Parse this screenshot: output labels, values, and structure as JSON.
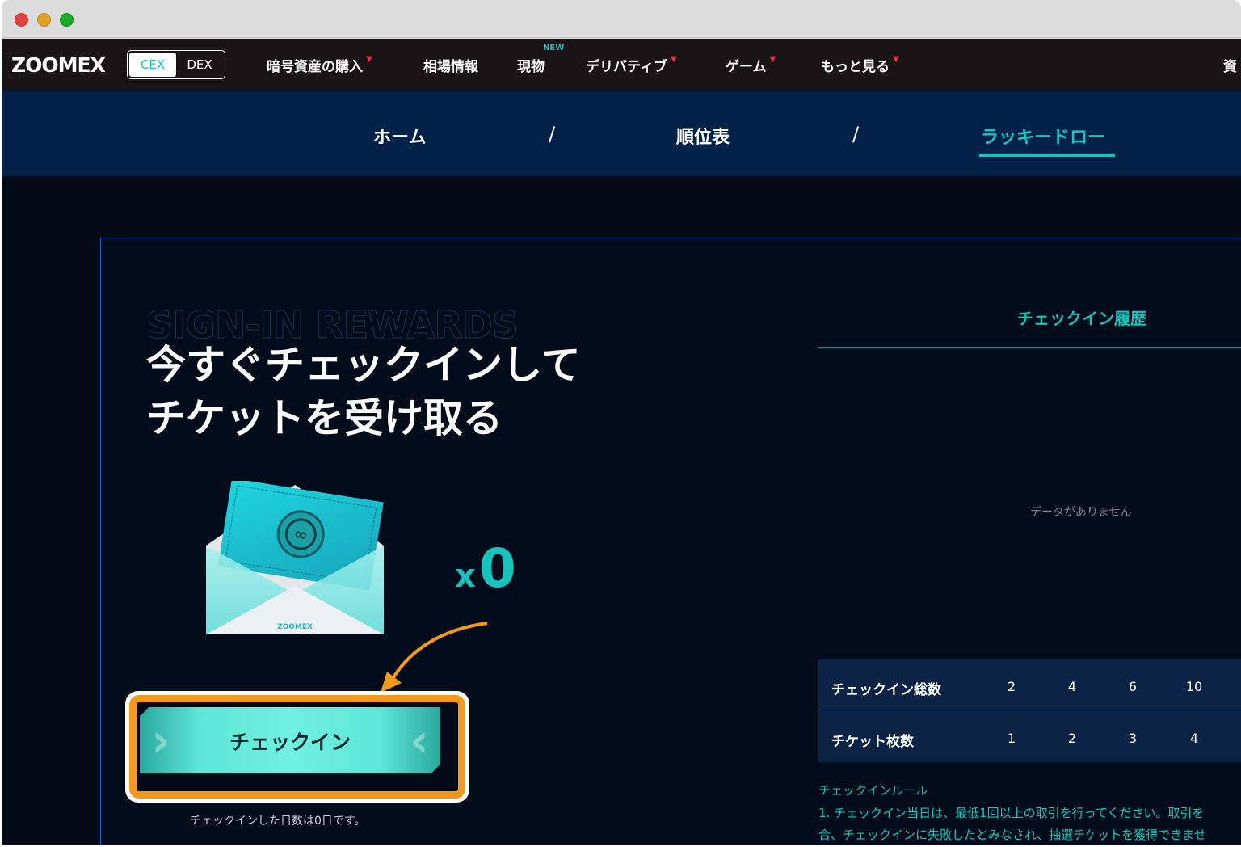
{
  "nav": {
    "logo": "ZOOMEX",
    "switch": {
      "cex": "CEX",
      "dex": "DEX"
    },
    "items": [
      {
        "label": "暗号資産の購入",
        "caret": "▼"
      },
      {
        "label": "相場情報"
      },
      {
        "label": "現物",
        "badge": "NEW"
      },
      {
        "label": "デリバティブ",
        "caret": "▼"
      },
      {
        "label": "ゲーム",
        "caret": "▼"
      },
      {
        "label": "もっと見る",
        "caret": "▼"
      }
    ],
    "right_truncated": "資"
  },
  "subnav": {
    "home": "ホーム",
    "ranking": "順位表",
    "lucky_draw": "ラッキードロー",
    "separator": "/"
  },
  "hero": {
    "ghost_text": "SIGN-IN REWARDS",
    "headline_line1": "今すぐチェックインして",
    "headline_line2": "チケットを受け取る",
    "envelope_brand": "ZOOMEX",
    "count_prefix": "x",
    "count_value": "0",
    "checkin_button": "チェックイン",
    "days_note": "チェックインした日数は0日です。"
  },
  "history": {
    "title": "チェックイン履歴",
    "empty": "データがありません"
  },
  "reward_table": {
    "row1_label": "チェックイン総数",
    "row1_values": [
      "2",
      "4",
      "6",
      "10"
    ],
    "row2_label": "チケット枚数",
    "row2_values": [
      "1",
      "2",
      "3",
      "4"
    ]
  },
  "rules": {
    "title": "チェックインルール",
    "line1": "1. チェックイン当日は、最低1回以上の取引を行ってください。取引を",
    "line2": "合、チェックインに失敗したとみなされ、抽選チケットを獲得できませ"
  },
  "colors": {
    "accent": "#17c4bd",
    "highlight": "#f39a1e",
    "navbar": "#1a1416",
    "subnav": "#03224a",
    "card_border": "#1e56c9"
  }
}
